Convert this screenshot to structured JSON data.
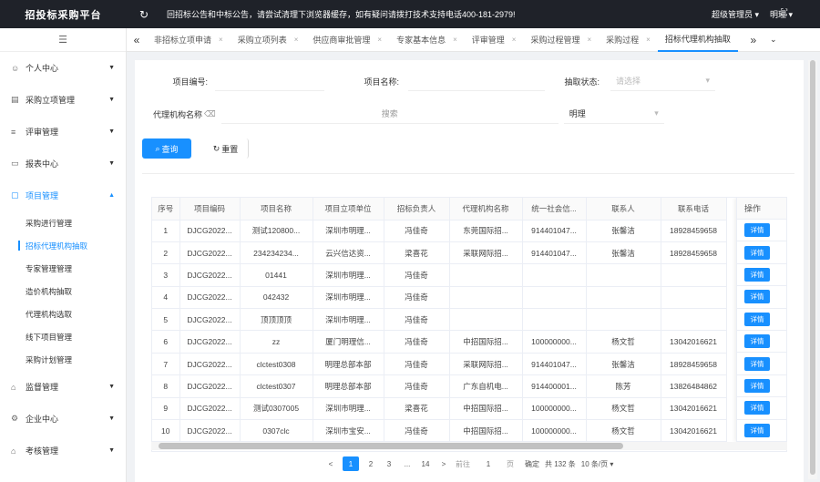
{
  "topbar": {
    "brand": "招投标采购平台",
    "notice": "回招标公告和中标公告，请尝试清理下浏览器缓存，如有疑问请拨打技术支持电话400-181-2979!",
    "role": "超级管理员 ▾",
    "username": "明理 ▾"
  },
  "sidebar": {
    "items": [
      {
        "icon": "user-icon",
        "label": "个人中心"
      },
      {
        "icon": "document-icon",
        "label": "采购立项管理"
      },
      {
        "icon": "list-icon",
        "label": "评审管理"
      },
      {
        "icon": "car-icon",
        "label": "报表中心"
      },
      {
        "icon": "folder-icon",
        "label": "项目管理"
      }
    ],
    "sub_items": [
      "采购进行管理",
      "招标代理机构抽取",
      "专家管理管理",
      "造价机构抽取",
      "代理机构选取",
      "线下项目管理",
      "采购计划管理"
    ],
    "bottom_items": [
      {
        "icon": "home-icon",
        "label": "监督管理"
      },
      {
        "icon": "gear-icon",
        "label": "企业中心"
      },
      {
        "icon": "home-icon",
        "label": "考核管理"
      }
    ]
  },
  "tabs": [
    "非招标立项申请",
    "采购立项列表",
    "供应商审批管理",
    "专家基本信息",
    "评审管理",
    "采购过程管理",
    "采购过程",
    "招标代理机构抽取"
  ],
  "form": {
    "project_no_label": "项目编号:",
    "project_name_label": "项目名称:",
    "status_label": "抽取状态:",
    "status_placeholder": "请选择",
    "agency_label": "代理机构名称",
    "agency_value": "搜索",
    "manager_value": "明理",
    "search_label": "查询",
    "reset_label": "重置"
  },
  "table": {
    "headers": [
      "序号",
      "项目编码",
      "项目名称",
      "项目立项单位",
      "招标负责人",
      "代理机构名称",
      "统一社会信...",
      "联系人",
      "联系电话",
      "操作"
    ],
    "rows": [
      [
        "1",
        "DJCG2022...",
        "测试120800...",
        "深圳市明理...",
        "冯佳奇",
        "东莞国际招...",
        "914401047...",
        "张馨洁",
        "18928459658"
      ],
      [
        "2",
        "DJCG2022...",
        "234234234...",
        "云兴信达资...",
        "梁喜花",
        "采联网际招...",
        "914401047...",
        "张馨洁",
        "18928459658"
      ],
      [
        "3",
        "DJCG2022...",
        "01441",
        "深圳市明理...",
        "冯佳奇",
        "",
        "",
        "",
        ""
      ],
      [
        "4",
        "DJCG2022...",
        "042432",
        "深圳市明理...",
        "冯佳奇",
        "",
        "",
        "",
        ""
      ],
      [
        "5",
        "DJCG2022...",
        "顶顶顶顶",
        "深圳市明理...",
        "冯佳奇",
        "",
        "",
        "",
        ""
      ],
      [
        "6",
        "DJCG2022...",
        "zz",
        "厦门明理信...",
        "冯佳奇",
        "中招国际招...",
        "100000000...",
        "杨文哲",
        "13042016621"
      ],
      [
        "7",
        "DJCG2022...",
        "clctest0308",
        "明理总部本部",
        "冯佳奇",
        "采联网际招...",
        "914401047...",
        "张馨洁",
        "18928459658"
      ],
      [
        "8",
        "DJCG2022...",
        "clctest0307",
        "明理总部本部",
        "冯佳奇",
        "广东自机电...",
        "914400001...",
        "陈芳",
        "13826484862"
      ],
      [
        "9",
        "DJCG2022...",
        "测试0307005",
        "深圳市明理...",
        "梁喜花",
        "中招国际招...",
        "100000000...",
        "杨文哲",
        "13042016621"
      ],
      [
        "10",
        "DJCG2022...",
        "0307clc",
        "深圳市宝安...",
        "冯佳奇",
        "中招国际招...",
        "100000000...",
        "杨文哲",
        "13042016621"
      ]
    ],
    "action_label": "详情"
  },
  "pagination": {
    "prev": "<",
    "pages": [
      "1",
      "2",
      "3",
      "...",
      "14"
    ],
    "next": ">",
    "goto_label": "前往",
    "goto_value": "1",
    "page_unit": "页",
    "confirm": "确定",
    "total": "共 132 条",
    "page_size": "10 条/页 ▾"
  }
}
